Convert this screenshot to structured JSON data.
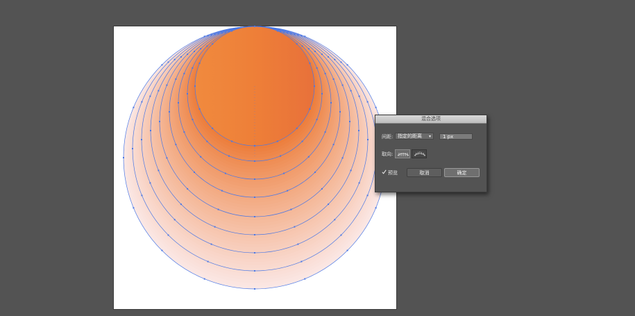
{
  "dialog": {
    "title": "混合选项",
    "spacing_label": "间距:",
    "spacing_mode": "指定的距离",
    "spacing_value": "1 px",
    "orientation_label": "取向:",
    "orientation_options": [
      "对齐页面",
      "对齐路径"
    ],
    "preview_label": "预览",
    "preview_checked": true,
    "cancel_label": "取消",
    "ok_label": "确定"
  },
  "artwork": {
    "top_color": "#ec7a35",
    "bottom_color": "#fbe7e4",
    "path_color": "#4a78e6",
    "background": "#535353",
    "artboard": "#ffffff"
  }
}
